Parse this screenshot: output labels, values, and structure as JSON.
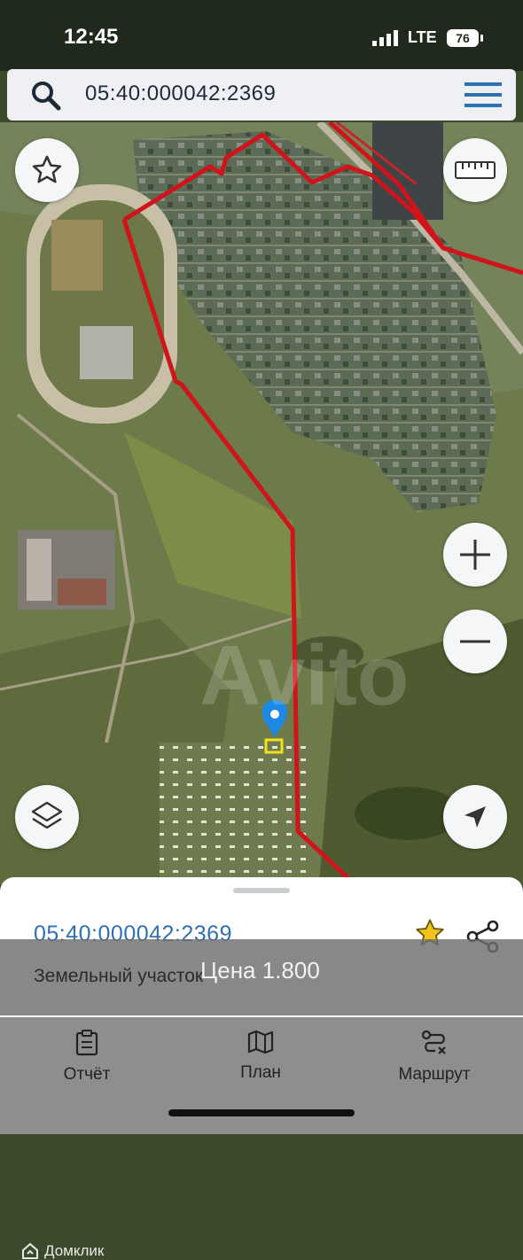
{
  "status_bar": {
    "time": "12:45",
    "network": "LTE",
    "battery": "76"
  },
  "search": {
    "query": "05:40:000042:2369"
  },
  "map": {
    "watermark": "Avito",
    "boundary_color": "#d0141b",
    "controls": {
      "favorite": "star-icon",
      "ruler": "ruler-icon",
      "zoom_in": "plus-icon",
      "zoom_out": "minus-icon",
      "layers": "layers-icon",
      "locate": "navigation-arrow-icon"
    }
  },
  "parcel": {
    "id": "05:40:000042:2369",
    "type": "Земельный участок",
    "price": "Цена 1.800"
  },
  "tabs": [
    {
      "label": "Отчёт",
      "icon": "report-icon"
    },
    {
      "label": "План",
      "icon": "map-plan-icon"
    },
    {
      "label": "Маршрут",
      "icon": "route-icon"
    }
  ],
  "brand": "Домклик",
  "colors": {
    "accent": "#2f6fb4",
    "star": "#f2c21b",
    "marker": "#1e88e5"
  }
}
